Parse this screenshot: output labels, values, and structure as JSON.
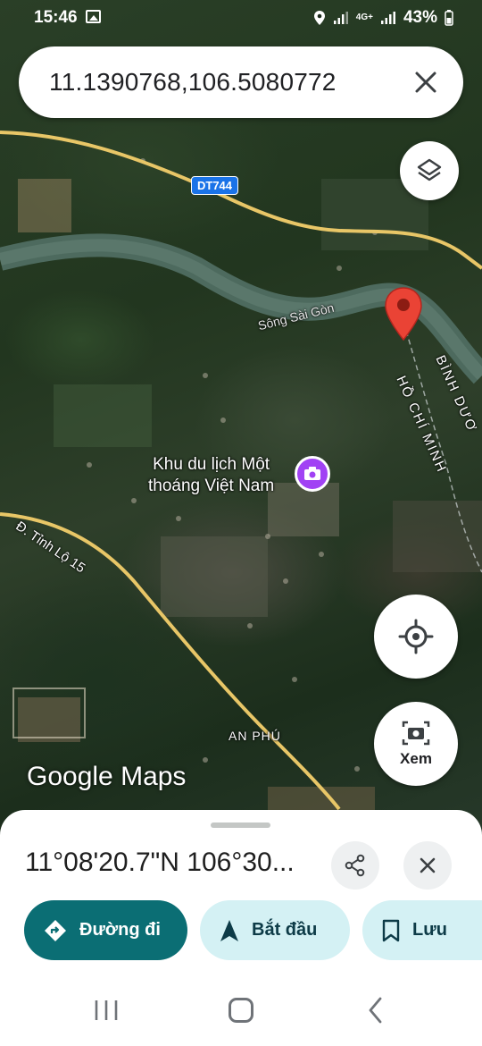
{
  "status_bar": {
    "time": "15:46",
    "network": "4G+",
    "battery": "43%"
  },
  "search": {
    "query": "11.1390768,106.5080772"
  },
  "map": {
    "road_shield": "DT744",
    "river_label": "Sông Sài Gòn",
    "poi_name": "Khu du lịch Một thoáng Việt Nam",
    "poi_line1": "Khu du lịch Một",
    "poi_line2": "thoáng Việt Nam",
    "road_label": "Đ. Tỉnh Lộ 15",
    "province_label_1": "HỒ CHÍ MINH",
    "province_label_2": "BÌNH DƯƠ",
    "area_label": "AN PHÚ",
    "logo": "Google Maps",
    "view_button_label": "Xem"
  },
  "place_sheet": {
    "coordinates": "11°08'20.7\"N 106°30...",
    "actions": {
      "directions": "Đường đi",
      "start": "Bắt đầu",
      "save": "Lưu"
    }
  },
  "colors": {
    "primary_action": "#0b6e74",
    "secondary_action": "#d4f1f4",
    "pin": "#ea4335",
    "poi": "#a142f4"
  }
}
